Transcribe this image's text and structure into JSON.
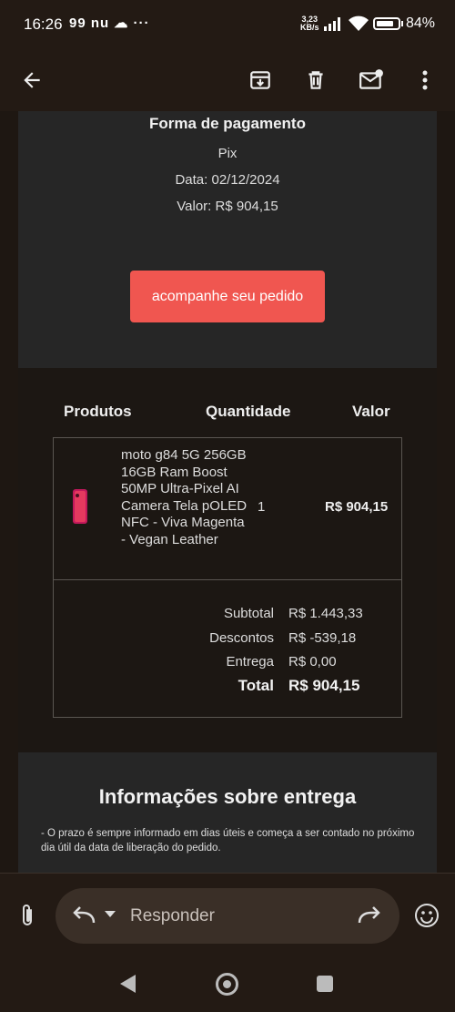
{
  "status_bar": {
    "time": "16:26",
    "left_icons": "99 nu ☁ ···",
    "net_speed_value": "3,23",
    "net_speed_unit": "KB/s",
    "battery_level": 0.84,
    "battery_text": "84%"
  },
  "app_bar": {
    "icons": [
      "back-arrow-icon",
      "archive-icon",
      "delete-icon",
      "mark-unread-icon",
      "more-icon"
    ]
  },
  "payment": {
    "title": "Forma de pagamento",
    "method": "Pix",
    "date": "Data: 02/12/2024",
    "value": "Valor: R$ 904,15",
    "track_button": "acompanhe seu pedido"
  },
  "products": {
    "headers": {
      "product": "Produtos",
      "quantity": "Quantidade",
      "value": "Valor"
    },
    "items": [
      {
        "name": "moto g84 5G 256GB 16GB Ram Boost 50MP Ultra-Pixel AI Camera Tela pOLED NFC - Viva Magenta - Vegan Leather",
        "quantity": "1",
        "price": "R$ 904,15"
      }
    ],
    "totals": {
      "subtotal_label": "Subtotal",
      "subtotal_value": "R$ 1.443,33",
      "discount_label": "Descontos",
      "discount_value": "R$ -539,18",
      "shipping_label": "Entrega",
      "shipping_value": "R$ 0,00",
      "total_label": "Total",
      "total_value": "R$ 904,15"
    }
  },
  "delivery": {
    "title": "Informações sobre entrega",
    "text": "- O prazo é sempre informado em dias úteis e começa a ser contado no próximo dia útil da data de liberação do pedido."
  },
  "reply_bar": {
    "placeholder": "Responder"
  },
  "colors": {
    "accent_button": "#f05650",
    "background": "#1e1712",
    "card": "#262626"
  }
}
